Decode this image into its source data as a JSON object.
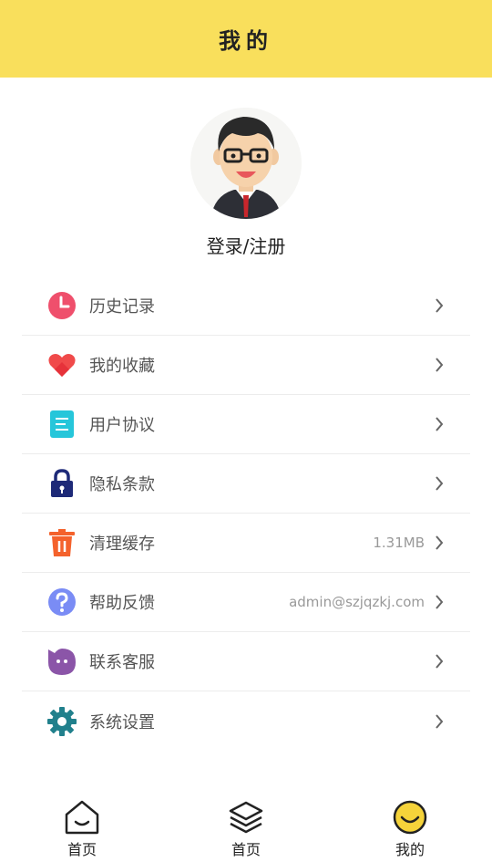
{
  "header": {
    "title": "我的"
  },
  "profile": {
    "login_label": "登录/注册"
  },
  "menu": {
    "items": [
      {
        "label": "历史记录",
        "value": "",
        "icon": "clock-icon",
        "color": "#ef4f6c"
      },
      {
        "label": "我的收藏",
        "value": "",
        "icon": "heart-icon",
        "color": "#f04a4a"
      },
      {
        "label": "用户协议",
        "value": "",
        "icon": "document-icon",
        "color": "#26c6da"
      },
      {
        "label": "隐私条款",
        "value": "",
        "icon": "lock-icon",
        "color": "#1e2a78"
      },
      {
        "label": "清理缓存",
        "value": "1.31MB",
        "icon": "trash-icon",
        "color": "#f4622c"
      },
      {
        "label": "帮助反馈",
        "value": "admin@szjqzkj.com",
        "icon": "question-icon",
        "color": "#7a8cf5"
      },
      {
        "label": "联系客服",
        "value": "",
        "icon": "chat-face-icon",
        "color": "#8b55a8"
      },
      {
        "label": "系统设置",
        "value": "",
        "icon": "gear-icon",
        "color": "#21808c"
      }
    ]
  },
  "tabbar": {
    "tabs": [
      {
        "label": "首页",
        "icon": "home-icon"
      },
      {
        "label": "首页",
        "icon": "layers-icon"
      },
      {
        "label": "我的",
        "icon": "smile-icon",
        "active": true
      }
    ]
  },
  "colors": {
    "header_bg": "#f9df5c",
    "accent": "#f5d33a"
  }
}
